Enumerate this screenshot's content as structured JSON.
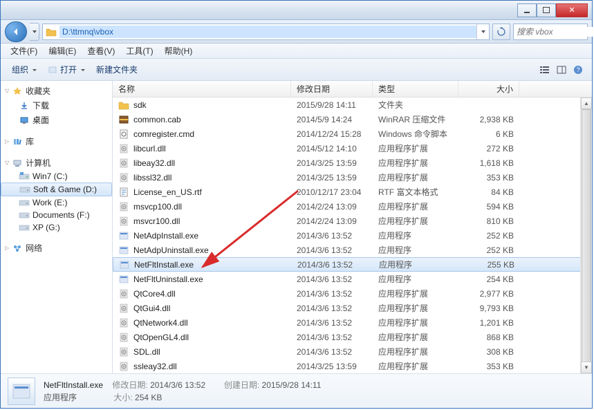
{
  "address_path": "D:\\ttmnq\\vbox",
  "search_placeholder": "搜索 vbox",
  "menus": {
    "file": "文件(F)",
    "edit": "编辑(E)",
    "view": "查看(V)",
    "tools": "工具(T)",
    "help": "帮助(H)"
  },
  "toolbar": {
    "organize": "组织",
    "open": "打开",
    "new_folder": "新建文件夹"
  },
  "columns": {
    "name": "名称",
    "date": "修改日期",
    "type": "类型",
    "size": "大小"
  },
  "nav": {
    "favorites": {
      "label": "收藏夹",
      "children": [
        {
          "label": "下载",
          "icon": "download"
        },
        {
          "label": "桌面",
          "icon": "desktop"
        }
      ]
    },
    "libraries": {
      "label": "库"
    },
    "computer": {
      "label": "计算机",
      "children": [
        {
          "label": "Win7 (C:)",
          "icon": "drive-sys"
        },
        {
          "label": "Soft & Game (D:)",
          "icon": "drive",
          "selected": true
        },
        {
          "label": "Work (E:)",
          "icon": "drive"
        },
        {
          "label": "Documents (F:)",
          "icon": "drive"
        },
        {
          "label": "XP (G:)",
          "icon": "drive"
        }
      ]
    },
    "network": {
      "label": "网络"
    }
  },
  "files": [
    {
      "name": "sdk",
      "date": "2015/9/28 14:11",
      "type": "文件夹",
      "size": "",
      "icon": "folder"
    },
    {
      "name": "common.cab",
      "date": "2014/5/9 14:24",
      "type": "WinRAR 压缩文件",
      "size": "2,938 KB",
      "icon": "cab"
    },
    {
      "name": "comregister.cmd",
      "date": "2014/12/24 15:28",
      "type": "Windows 命令脚本",
      "size": "6 KB",
      "icon": "cmd"
    },
    {
      "name": "libcurl.dll",
      "date": "2014/5/12 14:10",
      "type": "应用程序扩展",
      "size": "272 KB",
      "icon": "dll"
    },
    {
      "name": "libeay32.dll",
      "date": "2014/3/25 13:59",
      "type": "应用程序扩展",
      "size": "1,618 KB",
      "icon": "dll"
    },
    {
      "name": "libssl32.dll",
      "date": "2014/3/25 13:59",
      "type": "应用程序扩展",
      "size": "353 KB",
      "icon": "dll"
    },
    {
      "name": "License_en_US.rtf",
      "date": "2010/12/17 23:04",
      "type": "RTF 富文本格式",
      "size": "84 KB",
      "icon": "rtf"
    },
    {
      "name": "msvcp100.dll",
      "date": "2014/2/24 13:09",
      "type": "应用程序扩展",
      "size": "594 KB",
      "icon": "dll"
    },
    {
      "name": "msvcr100.dll",
      "date": "2014/2/24 13:09",
      "type": "应用程序扩展",
      "size": "810 KB",
      "icon": "dll"
    },
    {
      "name": "NetAdpInstall.exe",
      "date": "2014/3/6 13:52",
      "type": "应用程序",
      "size": "252 KB",
      "icon": "exe"
    },
    {
      "name": "NetAdpUninstall.exe",
      "date": "2014/3/6 13:52",
      "type": "应用程序",
      "size": "252 KB",
      "icon": "exe"
    },
    {
      "name": "NetFltInstall.exe",
      "date": "2014/3/6 13:52",
      "type": "应用程序",
      "size": "255 KB",
      "icon": "exe",
      "selected": true
    },
    {
      "name": "NetFltUninstall.exe",
      "date": "2014/3/6 13:52",
      "type": "应用程序",
      "size": "254 KB",
      "icon": "exe"
    },
    {
      "name": "QtCore4.dll",
      "date": "2014/3/6 13:52",
      "type": "应用程序扩展",
      "size": "2,977 KB",
      "icon": "dll"
    },
    {
      "name": "QtGui4.dll",
      "date": "2014/3/6 13:52",
      "type": "应用程序扩展",
      "size": "9,793 KB",
      "icon": "dll"
    },
    {
      "name": "QtNetwork4.dll",
      "date": "2014/3/6 13:52",
      "type": "应用程序扩展",
      "size": "1,201 KB",
      "icon": "dll"
    },
    {
      "name": "QtOpenGL4.dll",
      "date": "2014/3/6 13:52",
      "type": "应用程序扩展",
      "size": "868 KB",
      "icon": "dll"
    },
    {
      "name": "SDL.dll",
      "date": "2014/3/6 13:52",
      "type": "应用程序扩展",
      "size": "308 KB",
      "icon": "dll"
    },
    {
      "name": "ssleay32.dll",
      "date": "2014/3/25 13:59",
      "type": "应用程序扩展",
      "size": "353 KB",
      "icon": "dll"
    }
  ],
  "details": {
    "name": "NetFltInstall.exe",
    "type": "应用程序",
    "mod_label": "修改日期:",
    "mod_value": "2014/3/6 13:52",
    "size_label": "大小:",
    "size_value": "254 KB",
    "created_label": "创建日期:",
    "created_value": "2015/9/28 14:11"
  }
}
